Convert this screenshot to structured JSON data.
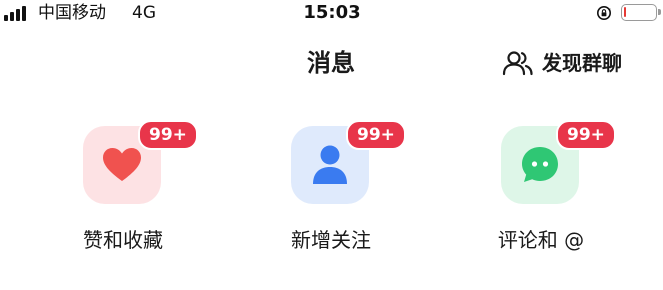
{
  "status_bar": {
    "carrier": "中国移动",
    "network": "4G",
    "time": "15:03",
    "battery_color": "#e53935"
  },
  "header": {
    "title": "消息",
    "group_chat_label": "发现群聊",
    "group_chat_icon": "people-icon"
  },
  "tiles": [
    {
      "label": "赞和收藏",
      "badge": "99+",
      "icon": "heart-icon",
      "icon_color": "#f0524f"
    },
    {
      "label": "新增关注",
      "badge": "99+",
      "icon": "person-icon",
      "icon_color": "#3a7bf0"
    },
    {
      "label": "评论和 @",
      "badge": "99+",
      "icon": "chat-bubble-icon",
      "icon_color": "#2fc774"
    }
  ],
  "colors": {
    "badge": "#e8354a",
    "text": "#1a1a1a",
    "background": "#ffffff"
  }
}
